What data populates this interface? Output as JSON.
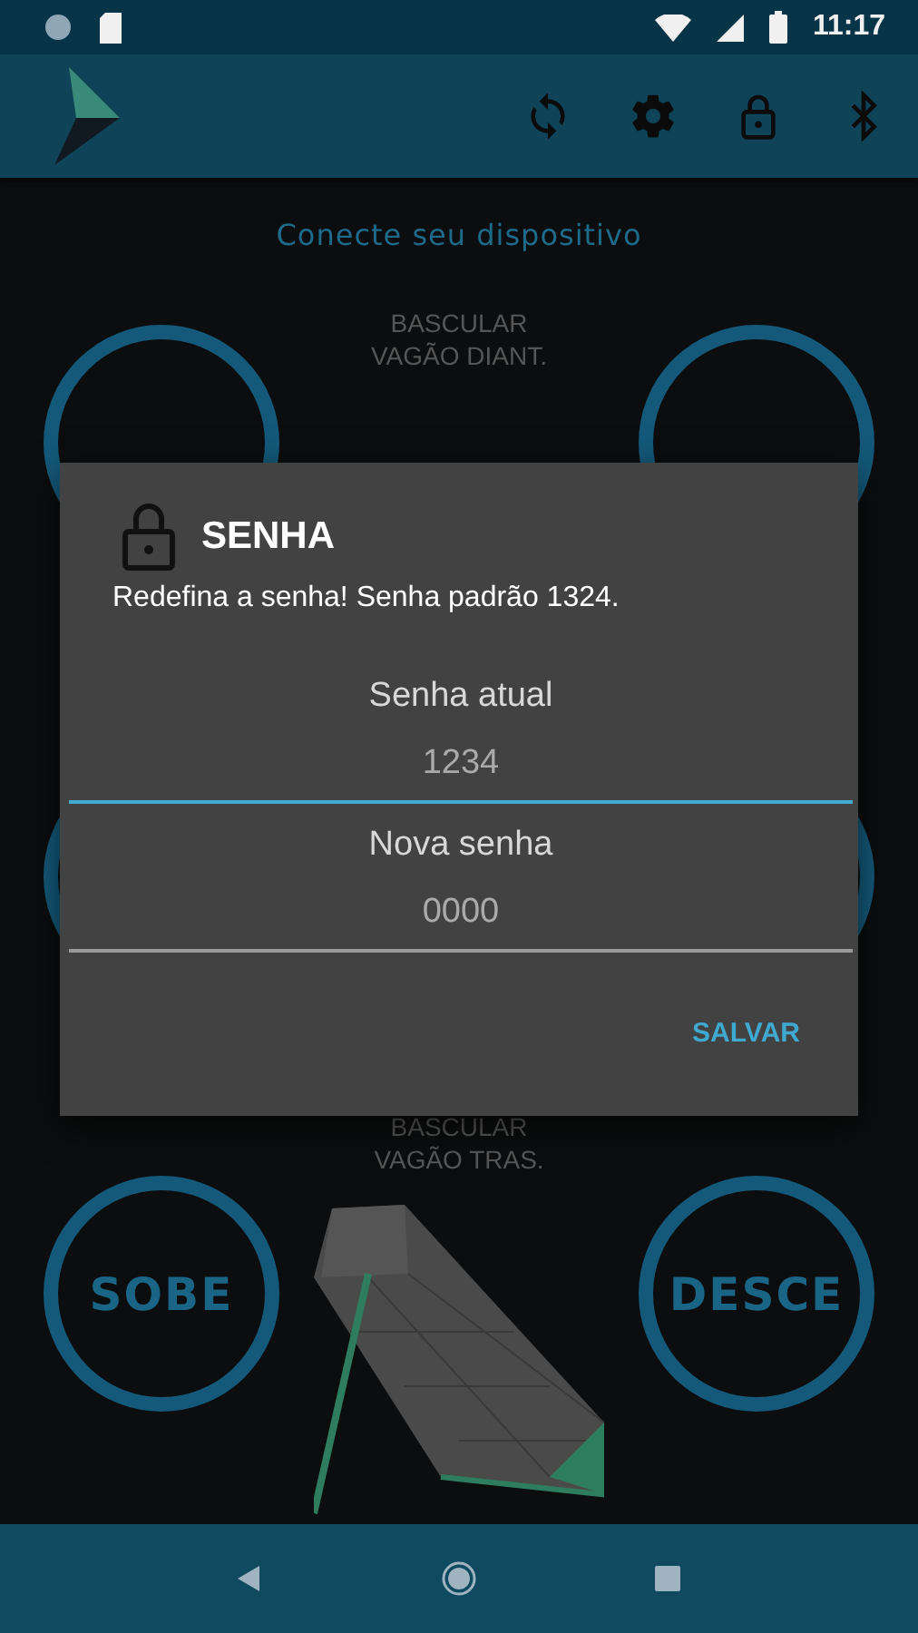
{
  "status_bar": {
    "time": "11:17"
  },
  "app_bar": {
    "actions": [
      {
        "kind": "sync"
      },
      {
        "kind": "settings"
      },
      {
        "kind": "lock"
      },
      {
        "kind": "bluetooth"
      }
    ]
  },
  "connection_status": "Conecte seu dispositivo",
  "front_wagon": {
    "label": "BASCULAR\nVAGÃO DIANT."
  },
  "rear_wagon": {
    "label": "BASCULAR\nVAGÃO TRAS.",
    "up_button": "SOBE",
    "down_button": "DESCE"
  },
  "dialog": {
    "title": "SENHA",
    "message": "Redefina a senha! Senha padrão 1324.",
    "fields": [
      {
        "label": "Senha atual",
        "value": "1234",
        "focused": true
      },
      {
        "label": "Nova senha",
        "placeholder": "0000",
        "focused": false
      }
    ],
    "actions": [
      "SALVAR"
    ]
  },
  "nav_bar": {
    "buttons": [
      {
        "kind": "back"
      },
      {
        "kind": "home"
      },
      {
        "kind": "recents"
      }
    ]
  }
}
